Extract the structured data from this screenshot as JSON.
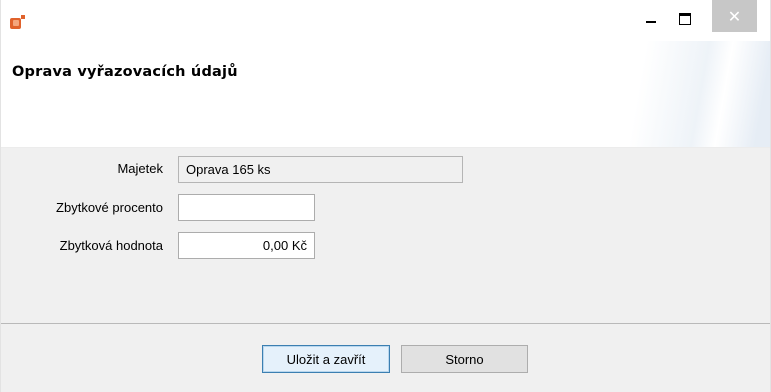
{
  "window": {
    "icon": "app-logo-icon",
    "controls": {
      "minimize": "minimize-icon",
      "maximize": "maximize-icon",
      "close_glyph": "✕"
    }
  },
  "header": {
    "title": "Oprava vyřazovacích údajů"
  },
  "form": {
    "majetek_label": "Majetek",
    "majetek_value": "Oprava 165 ks",
    "zbytkove_procento_label": "Zbytkové procento",
    "zbytkove_procento_value": "",
    "zbytkova_hodnota_label": "Zbytková hodnota",
    "zbytkova_hodnota_value": "0,00 Kč"
  },
  "buttons": {
    "save_close": "Uložit a zavřít",
    "cancel": "Storno"
  }
}
